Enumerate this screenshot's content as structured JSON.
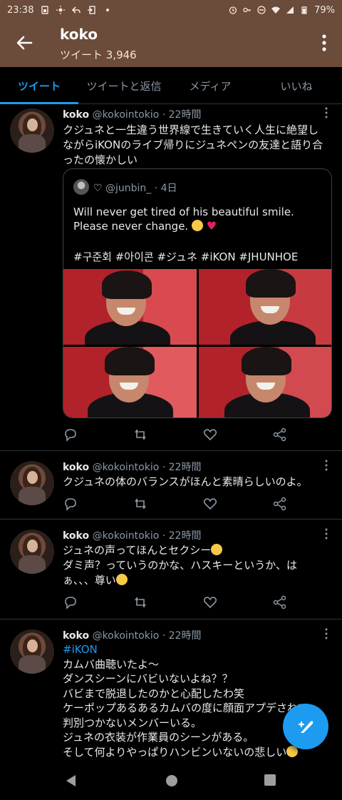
{
  "status_bar": {
    "time": "23:38",
    "battery": "79%",
    "icons_left": [
      "sim-icon",
      "brightness-icon",
      "reply-icon",
      "cast-icon",
      "dot-icon"
    ],
    "icons_right": [
      "alarm-icon",
      "key-icon",
      "dnd-icon",
      "wifi-icon",
      "signal-icon",
      "battery-icon"
    ]
  },
  "header": {
    "title": "koko",
    "subtitle": "ツイート 3,946"
  },
  "tabs": [
    {
      "label": "ツイート",
      "active": true
    },
    {
      "label": "ツイートと返信",
      "active": false
    },
    {
      "label": "メディア",
      "active": false
    },
    {
      "label": "いいね",
      "active": false
    }
  ],
  "tweets": [
    {
      "name": "koko",
      "handle": "@kokointokio · 22時間",
      "lines": [
        "クジュネと一生違う世界線で生きていく人生に絶望し",
        "ながらiKONのライブ帰りにジュネペンの友達と語り合",
        "ったの懐かしい"
      ],
      "quote": {
        "handle": "@junbin_ · 4日",
        "text": "Will never get tired of his beautiful smile. Please never change.",
        "tags": "#구준회 #아이콘 #ジュネ #iKON #JHUNHOE",
        "photos": 4
      }
    },
    {
      "name": "koko",
      "handle": "@kokointokio · 22時間",
      "lines": [
        "クジュネの体のバランスがほんと素晴らしいのよ。"
      ]
    },
    {
      "name": "koko",
      "handle": "@kokointokio · 22時間",
      "lines": [
        "ジュネの声ってほんとセクシー",
        "ダミ声？っていうのかな、ハスキーというか、は",
        "ぁ、、、尊い"
      ]
    },
    {
      "name": "koko",
      "handle": "@kokointokio · 22時間",
      "hashtag": "#iKON",
      "lines": [
        "カムバ曲聴いたよ〜",
        "ダンスシーンにバビいないよね？？",
        "バビまで脱退したのかと心配したわ笑",
        "ケーポップあるあるカムバの度に顔面アプデされて",
        "判別つかないメンバーいる。",
        "ジュネの衣装が作業員のシーンがある。",
        "そして何よりやっぱりハンビンいないの悲しい"
      ]
    }
  ],
  "colors": {
    "accent": "#1d9bf0",
    "header_bg": "#6b4b3a",
    "heart": "#e0245e"
  }
}
